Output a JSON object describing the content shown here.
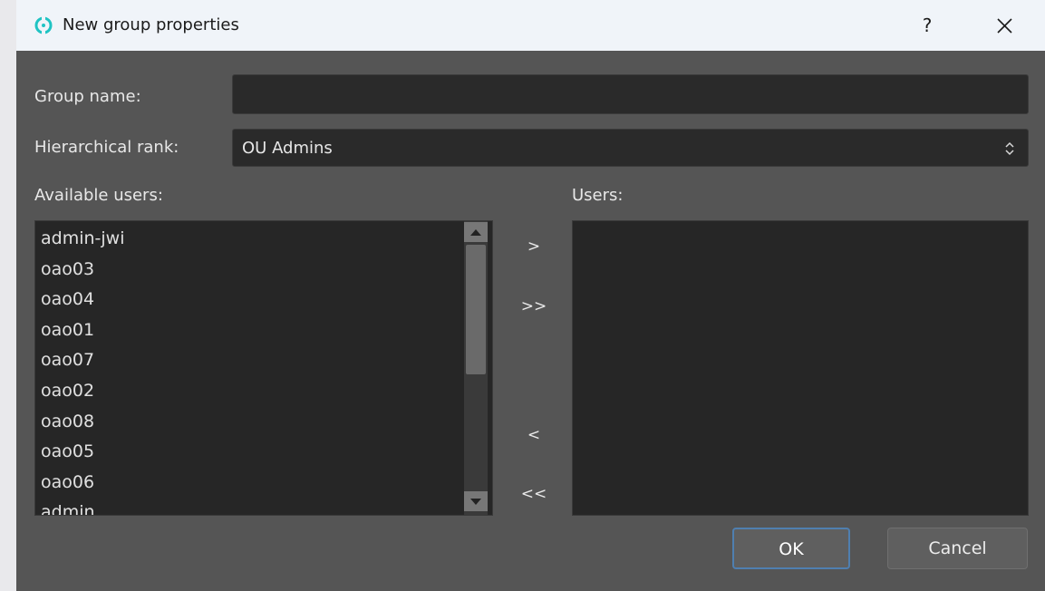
{
  "window": {
    "title": "New group properties",
    "help_label": "?",
    "app_icon": "app-ring-icon",
    "accent_color": "#1fc3c3"
  },
  "form": {
    "group_name_label": "Group name:",
    "group_name_value": "",
    "rank_label": "Hierarchical rank:",
    "rank_value": "OU Admins",
    "available_label": "Available users:",
    "users_label": "Users:"
  },
  "available_users": [
    "admin-jwi",
    "oao03",
    "oao04",
    "oao01",
    "oao07",
    "oao02",
    "oao08",
    "oao05",
    "oao06",
    "admin"
  ],
  "selected_users": [],
  "move_buttons": {
    "add": ">",
    "add_all": ">>",
    "remove": "<",
    "remove_all": "<<"
  },
  "footer": {
    "ok_label": "OK",
    "cancel_label": "Cancel"
  }
}
